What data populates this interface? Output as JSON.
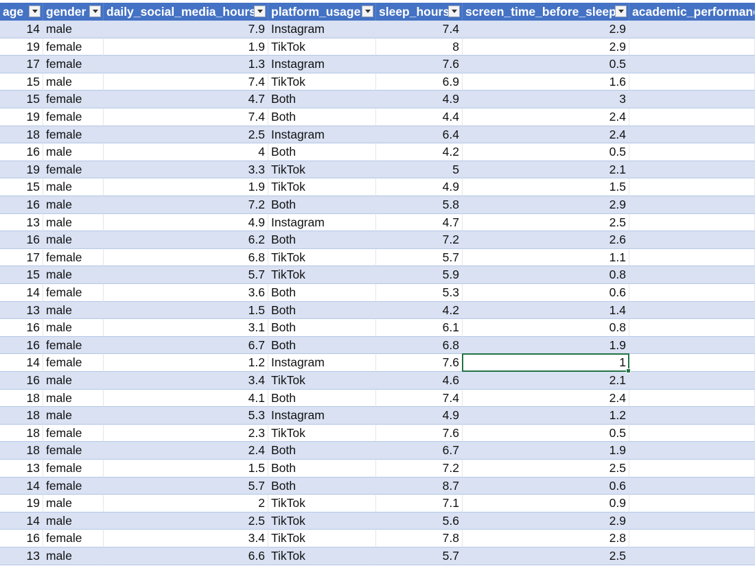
{
  "colors": {
    "header_bg": "#4472c4",
    "band": "#d9e1f2",
    "selection": "#217346"
  },
  "table": {
    "headers": [
      "age",
      "gender",
      "daily_social_media_hours",
      "platform_usage",
      "sleep_hours",
      "screen_time_before_sleep",
      "academic_performanc"
    ],
    "filter_icon": "filter-dropdown-icon",
    "rows": [
      [
        "14",
        "male",
        "7.9",
        "Instagram",
        "7.4",
        "2.9"
      ],
      [
        "19",
        "female",
        "1.9",
        "TikTok",
        "8",
        "2.9"
      ],
      [
        "17",
        "female",
        "1.3",
        "Instagram",
        "7.6",
        "0.5"
      ],
      [
        "15",
        "male",
        "7.4",
        "TikTok",
        "6.9",
        "1.6"
      ],
      [
        "15",
        "female",
        "4.7",
        "Both",
        "4.9",
        "3"
      ],
      [
        "19",
        "female",
        "7.4",
        "Both",
        "4.4",
        "2.4"
      ],
      [
        "18",
        "female",
        "2.5",
        "Instagram",
        "6.4",
        "2.4"
      ],
      [
        "16",
        "male",
        "4",
        "Both",
        "4.2",
        "0.5"
      ],
      [
        "19",
        "female",
        "3.3",
        "TikTok",
        "5",
        "2.1"
      ],
      [
        "15",
        "male",
        "1.9",
        "TikTok",
        "4.9",
        "1.5"
      ],
      [
        "16",
        "male",
        "7.2",
        "Both",
        "5.8",
        "2.9"
      ],
      [
        "13",
        "male",
        "4.9",
        "Instagram",
        "4.7",
        "2.5"
      ],
      [
        "16",
        "male",
        "6.2",
        "Both",
        "7.2",
        "2.6"
      ],
      [
        "17",
        "female",
        "6.8",
        "TikTok",
        "5.7",
        "1.1"
      ],
      [
        "15",
        "male",
        "5.7",
        "TikTok",
        "5.9",
        "0.8"
      ],
      [
        "14",
        "female",
        "3.6",
        "Both",
        "5.3",
        "0.6"
      ],
      [
        "13",
        "male",
        "1.5",
        "Both",
        "4.2",
        "1.4"
      ],
      [
        "16",
        "male",
        "3.1",
        "Both",
        "6.1",
        "0.8"
      ],
      [
        "16",
        "female",
        "6.7",
        "Both",
        "6.8",
        "1.9"
      ],
      [
        "14",
        "female",
        "1.2",
        "Instagram",
        "7.6",
        "1"
      ],
      [
        "16",
        "male",
        "3.4",
        "TikTok",
        "4.6",
        "2.1"
      ],
      [
        "18",
        "male",
        "4.1",
        "Both",
        "7.4",
        "2.4"
      ],
      [
        "18",
        "male",
        "5.3",
        "Instagram",
        "4.9",
        "1.2"
      ],
      [
        "18",
        "female",
        "2.3",
        "TikTok",
        "7.6",
        "0.5"
      ],
      [
        "18",
        "female",
        "2.4",
        "Both",
        "6.7",
        "1.9"
      ],
      [
        "13",
        "female",
        "1.5",
        "Both",
        "7.2",
        "2.5"
      ],
      [
        "14",
        "female",
        "5.7",
        "Both",
        "8.7",
        "0.6"
      ],
      [
        "19",
        "male",
        "2",
        "TikTok",
        "7.1",
        "0.9"
      ],
      [
        "14",
        "male",
        "2.5",
        "TikTok",
        "5.6",
        "2.9"
      ],
      [
        "16",
        "female",
        "3.4",
        "TikTok",
        "7.8",
        "2.8"
      ],
      [
        "13",
        "male",
        "6.6",
        "TikTok",
        "5.7",
        "2.5"
      ]
    ],
    "selected_row_index": 19,
    "selected_column_index": 5
  }
}
